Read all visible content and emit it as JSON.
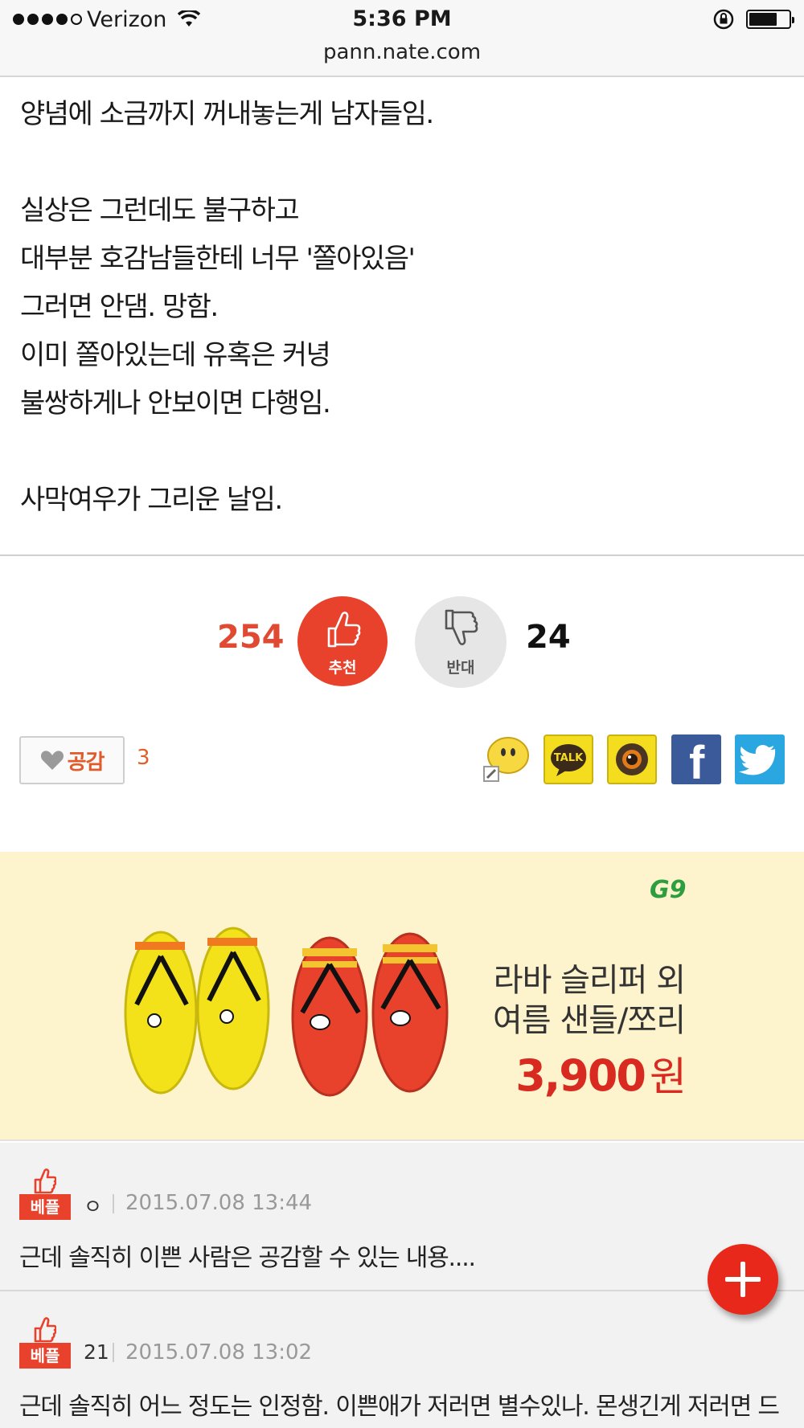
{
  "status_bar": {
    "carrier": "Verizon",
    "time": "5:36 PM",
    "signal_bars": 4,
    "signal_total": 5
  },
  "browser": {
    "url": "pann.nate.com"
  },
  "article": {
    "lines": [
      "양념에 소금까지 꺼내놓는게 남자들임.",
      "",
      "실상은 그런데도 불구하고",
      "대부분 호감남들한테 너무 '쫄아있음'",
      "그러면 안댐. 망함.",
      "이미 쫄아있는데 유혹은 커녕",
      "불쌍하게나 안보이면 다행임.",
      "",
      "사막여우가 그리운 날임."
    ]
  },
  "votes": {
    "recommend_count": "254",
    "recommend_label": "추천",
    "oppose_label": "반대",
    "oppose_count": "24"
  },
  "empathy": {
    "label": "공감",
    "count": "3"
  },
  "share": {
    "items": [
      {
        "name": "comment",
        "icon": "speech-smiley-icon"
      },
      {
        "name": "kakaotalk",
        "icon": "talk-icon",
        "label": "TALK"
      },
      {
        "name": "kakaostory",
        "icon": "camera-icon"
      },
      {
        "name": "facebook",
        "icon": "facebook-icon",
        "label": "f"
      },
      {
        "name": "twitter",
        "icon": "twitter-bird-icon"
      }
    ]
  },
  "ad": {
    "brand": "G9",
    "line1": "라바 슬리퍼 외",
    "line2": "여름 샌들/쪼리",
    "price": "3,900",
    "currency": "원"
  },
  "comments": [
    {
      "badge": "베플",
      "author": "ㅇ",
      "date": "2015.07.08 13:44",
      "text": "근데 솔직히 이쁜 사람은 공감할 수 있는 내용...."
    },
    {
      "badge": "베플",
      "author": "21",
      "date": "2015.07.08 13:02",
      "text": "근데 솔직히 어느 정도는 인정함. 이쁜애가 저러면 별수있나. 몬생긴게 저러면 드"
    }
  ],
  "colors": {
    "accent": "#e8412c",
    "oppose_bg": "#e6e6e6",
    "ad_bg": "#fdf3cc",
    "facebook": "#3b5a9a",
    "twitter": "#2aa7e1",
    "kakao": "#f4dd1e"
  }
}
